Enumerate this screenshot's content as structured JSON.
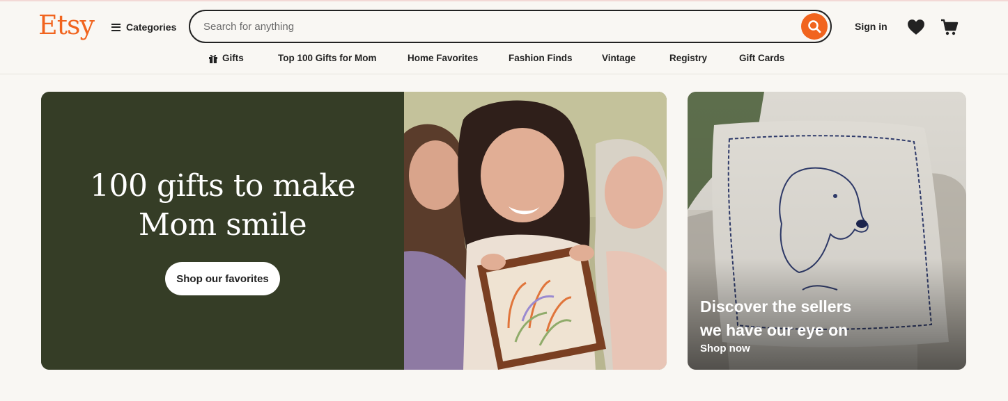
{
  "header": {
    "logo": "Etsy",
    "categories_label": "Categories",
    "search_placeholder": "Search for anything",
    "sign_in": "Sign in"
  },
  "nav": {
    "items": [
      {
        "label": "Gifts",
        "icon": "gift-icon"
      },
      {
        "label": "Top 100 Gifts for Mom"
      },
      {
        "label": "Home Favorites"
      },
      {
        "label": "Fashion Finds"
      },
      {
        "label": "Vintage"
      },
      {
        "label": "Registry"
      },
      {
        "label": "Gift Cards"
      }
    ]
  },
  "hero": {
    "title_line1": "100 gifts to make",
    "title_line2": "Mom smile",
    "button_label": "Shop our favorites"
  },
  "side_card": {
    "title_line1": "Discover the sellers",
    "title_line2": "we have our eye on",
    "link_label": "Shop now"
  },
  "colors": {
    "brand_orange": "#f1641e",
    "hero_green": "#353d26",
    "page_background": "#f9f7f3"
  },
  "icons": [
    "hamburger-icon",
    "search-icon",
    "heart-icon",
    "cart-icon",
    "gift-icon"
  ]
}
